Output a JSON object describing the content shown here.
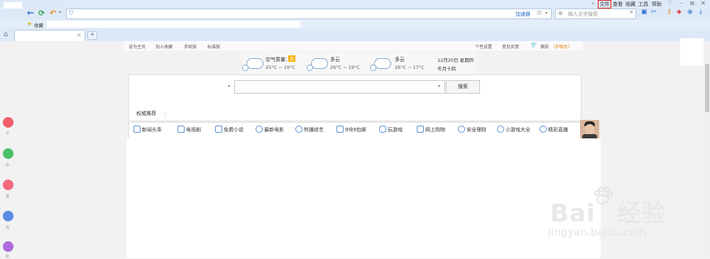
{
  "titlebar": {
    "menu": [
      "文件",
      "查看",
      "收藏",
      "工具",
      "帮助"
    ],
    "chevrons": "»"
  },
  "navbar": {
    "address_text": "",
    "speed_label": "加速器",
    "search_placeholder": "输入文字搜索"
  },
  "favorites": {
    "label": "收藏"
  },
  "tab": {
    "title": "",
    "close": "×",
    "new": "+"
  },
  "topnav": {
    "left_links": [
      "设为主页",
      "加入收藏",
      "手机版",
      "标准版"
    ],
    "right_links": [
      "个性设置",
      "意见反馈"
    ],
    "skin_label": "换肤",
    "skin_extra": "（护眼色）"
  },
  "weather": {
    "today": {
      "label": "空气质量：",
      "badge": "良",
      "temp": "25°C ~ 19°C"
    },
    "day2": {
      "cond": "多云",
      "temp": "26°C ~ 19°C"
    },
    "day3": {
      "cond": "多云",
      "temp": "26°C ~ 17°C"
    },
    "date": "12月20日 星期四",
    "lunar": "冬月十四"
  },
  "search": {
    "button": "搜索"
  },
  "recommend": {
    "label": "权威推荐"
  },
  "categories": [
    "新闻头条",
    "电视剧",
    "免费小说",
    "最新电影",
    "热播综艺",
    "9块9包邮",
    "玩游戏",
    "网上购物",
    "安全理财",
    "小游戏大全",
    "精彩直播"
  ],
  "side_labels": [
    "识",
    "由",
    "盘",
    "找",
    "影"
  ],
  "watermark": {
    "brand": "Bai",
    "brand2": "经验",
    "url": "jingyan.baidu.com"
  },
  "colors": {
    "accent": "#e0201b",
    "chrome": "#dde9f7",
    "link": "#5a8fd0"
  }
}
